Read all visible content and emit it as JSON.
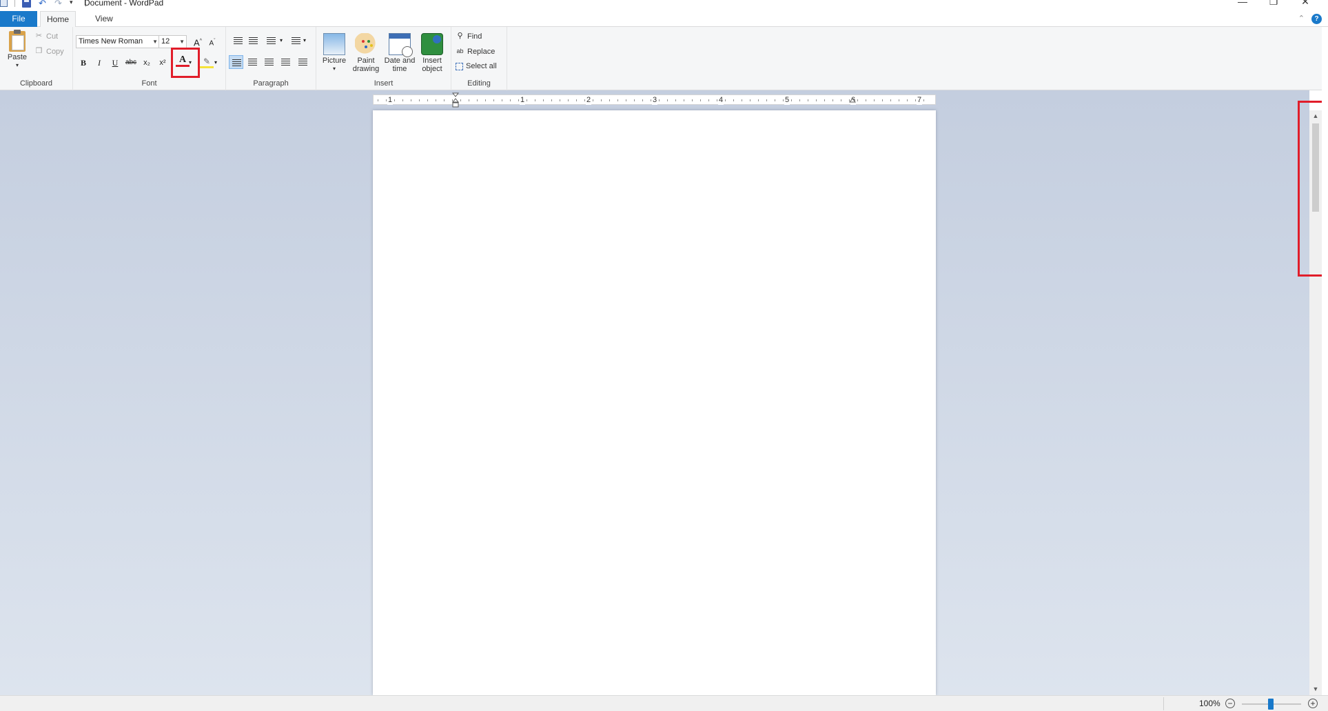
{
  "window": {
    "title": "Document - WordPad",
    "minimize_glyph": "—",
    "restore_glyph": "❐",
    "close_glyph": "✕"
  },
  "qat": {
    "undo_glyph": "↶",
    "redo_glyph": "↷",
    "more_glyph": "▾"
  },
  "tabs": {
    "file": "File",
    "home": "Home",
    "view": "View",
    "minimize_glyph": "⌃",
    "help_glyph": "?"
  },
  "clipboard": {
    "label": "Clipboard",
    "paste": "Paste",
    "paste_dropdown": "▾",
    "cut": "Cut",
    "copy": "Copy"
  },
  "font": {
    "label": "Font",
    "family": "Times New Roman",
    "size": "12",
    "grow_glyph": "A",
    "shrink_glyph": "A",
    "bold": "B",
    "italic": "I",
    "underline": "U",
    "strikethrough": "abc",
    "subscript": "x₂",
    "superscript": "x²",
    "color_glyph": "A",
    "highlight_glyph": "✎",
    "dropdown_glyph": "▾"
  },
  "paragraph": {
    "label": "Paragraph",
    "dropdown_glyph": "▾"
  },
  "insert": {
    "label": "Insert",
    "picture": "Picture",
    "picture_dropdown": "▾",
    "paint_drawing_1": "Paint",
    "paint_drawing_2": "drawing",
    "date_time_1": "Date and",
    "date_time_2": "time",
    "insert_object_1": "Insert",
    "insert_object_2": "object"
  },
  "editing": {
    "label": "Editing",
    "find": "Find",
    "replace": "Replace",
    "select_all": "Select all"
  },
  "ruler": {
    "numbers": [
      "1",
      "1",
      "2",
      "3",
      "4",
      "5",
      "6",
      "7"
    ]
  },
  "scrollbar": {
    "up_glyph": "▲",
    "down_glyph": "▼"
  },
  "status": {
    "zoom": "100%",
    "zoom_out_glyph": "−",
    "zoom_in_glyph": "+"
  },
  "colors": {
    "accent": "#1979ca",
    "highlight_box": "#e11d2a"
  }
}
